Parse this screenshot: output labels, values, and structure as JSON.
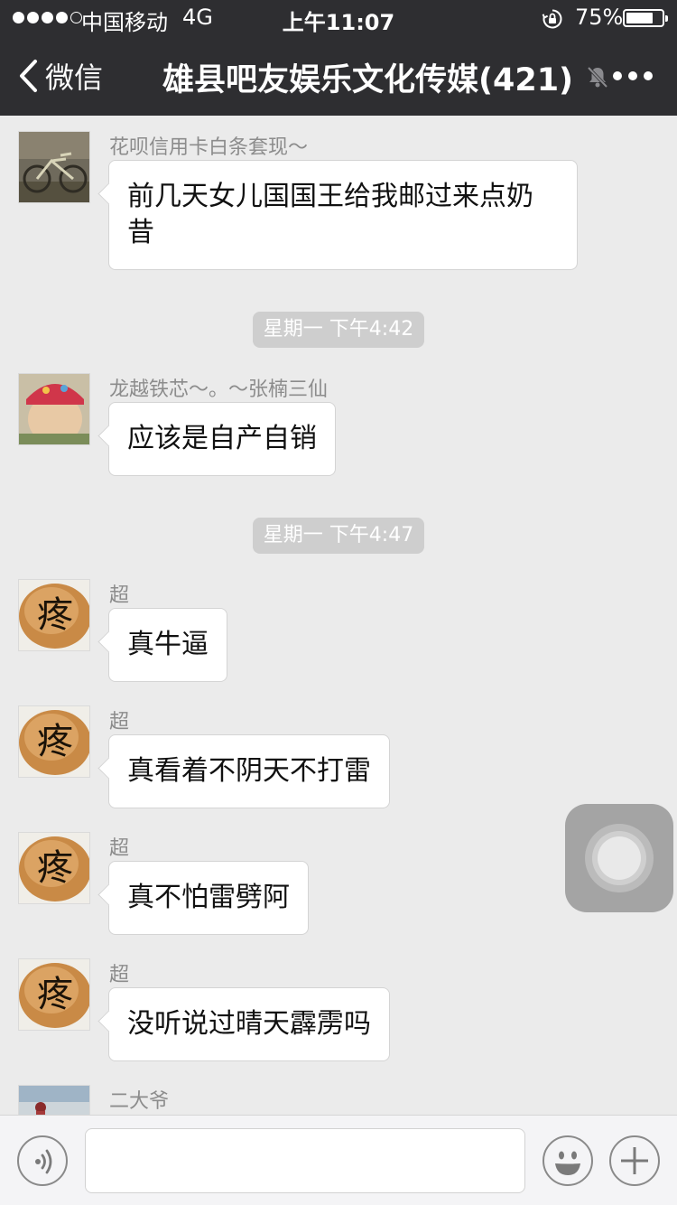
{
  "status_bar": {
    "carrier": "中国移动",
    "network": "4G",
    "time": "上午11:07",
    "battery_percent": "75%",
    "battery_level": 0.75,
    "signal_bars_filled": 4,
    "signal_bars_total": 5
  },
  "nav": {
    "back_label": "微信",
    "title": "雄县吧友娱乐文化传媒(421)"
  },
  "messages": [
    {
      "sender": "花呗信用卡白条套现～",
      "text": "前几天女儿国国王给我邮过来点奶昔",
      "avatar": "bicycle-photo"
    },
    {
      "timestamp": "星期一 下午4:42"
    },
    {
      "sender": "龙越铁芯～。～张楠三仙",
      "text": "应该是自产自销",
      "avatar": "baby-photo"
    },
    {
      "timestamp": "星期一 下午4:47"
    },
    {
      "sender": "超",
      "text": "真牛逼",
      "avatar": "egg-with-character"
    },
    {
      "sender": "超",
      "text": "真看着不阴天不打雷",
      "avatar": "egg-with-character"
    },
    {
      "sender": "超",
      "text": "真不怕雷劈阿",
      "avatar": "egg-with-character"
    },
    {
      "sender": "超",
      "text": "没听说过晴天霹雳吗",
      "avatar": "egg-with-character"
    },
    {
      "sender": "二大爷",
      "avatar": "beach-photo"
    }
  ],
  "egg_avatar_char": "疼",
  "input_bar": {
    "voice_icon": "voice-icon",
    "emoji_icon": "emoji-icon",
    "plus_icon": "plus-icon"
  },
  "colors": {
    "nav_background": "#2e2e31",
    "chat_background": "#ebebeb",
    "bubble_background": "#ffffff",
    "timestamp_background": "#cecece"
  }
}
